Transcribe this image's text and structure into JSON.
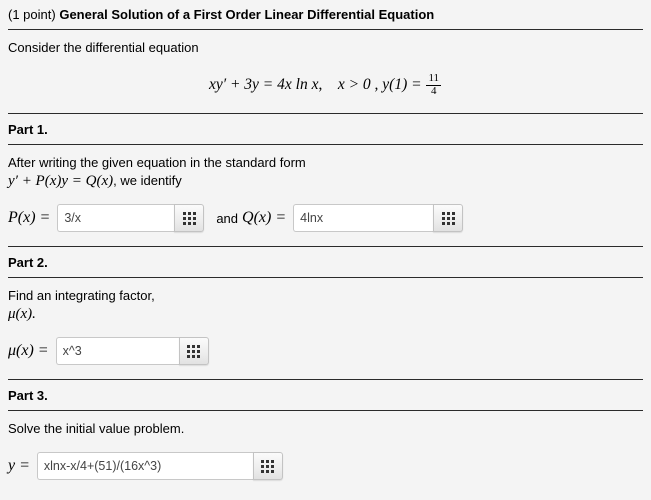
{
  "header": {
    "points": "(1 point)",
    "title": "General Solution of a First Order Linear Differential Equation"
  },
  "intro": {
    "text": "Consider the differential equation",
    "equation": {
      "lhs": "xy′ + 3y = 4x ln x",
      "comma": ",",
      "condition": "x > 0 , y(1) =",
      "fraction_numerator": "11",
      "fraction_denominator": "4"
    }
  },
  "parts": [
    {
      "title": "Part 1.",
      "prompt_line1": "After writing the given equation in the standard form",
      "prompt_math": "y′ + P(x)y = Q(x)",
      "prompt_tail": ", we identify",
      "fields": [
        {
          "label": "P(x) =",
          "value": "3/x",
          "placeholder": "",
          "button_icon": "grid-icon"
        },
        {
          "connector": "and",
          "label": "Q(x) =",
          "value": "4lnx",
          "placeholder": "",
          "button_icon": "grid-icon"
        }
      ]
    },
    {
      "title": "Part 2.",
      "prompt_line1": "Find an integrating factor,",
      "prompt_line2": "μ(x).",
      "fields": [
        {
          "label": "μ(x) =",
          "value": "x^3",
          "placeholder": "",
          "button_icon": "grid-icon"
        }
      ]
    },
    {
      "title": "Part 3.",
      "prompt_line1": "Solve the initial value problem.",
      "fields": [
        {
          "label": "y =",
          "value": "xlnx-x/4+(51)/(16x^3)",
          "placeholder": "",
          "button_icon": "grid-icon"
        }
      ]
    }
  ],
  "colors": {
    "page_background": "#f4f4f4",
    "rule": "#2b2b2b",
    "input_border": "#c8c8c8",
    "text": "#000000"
  }
}
